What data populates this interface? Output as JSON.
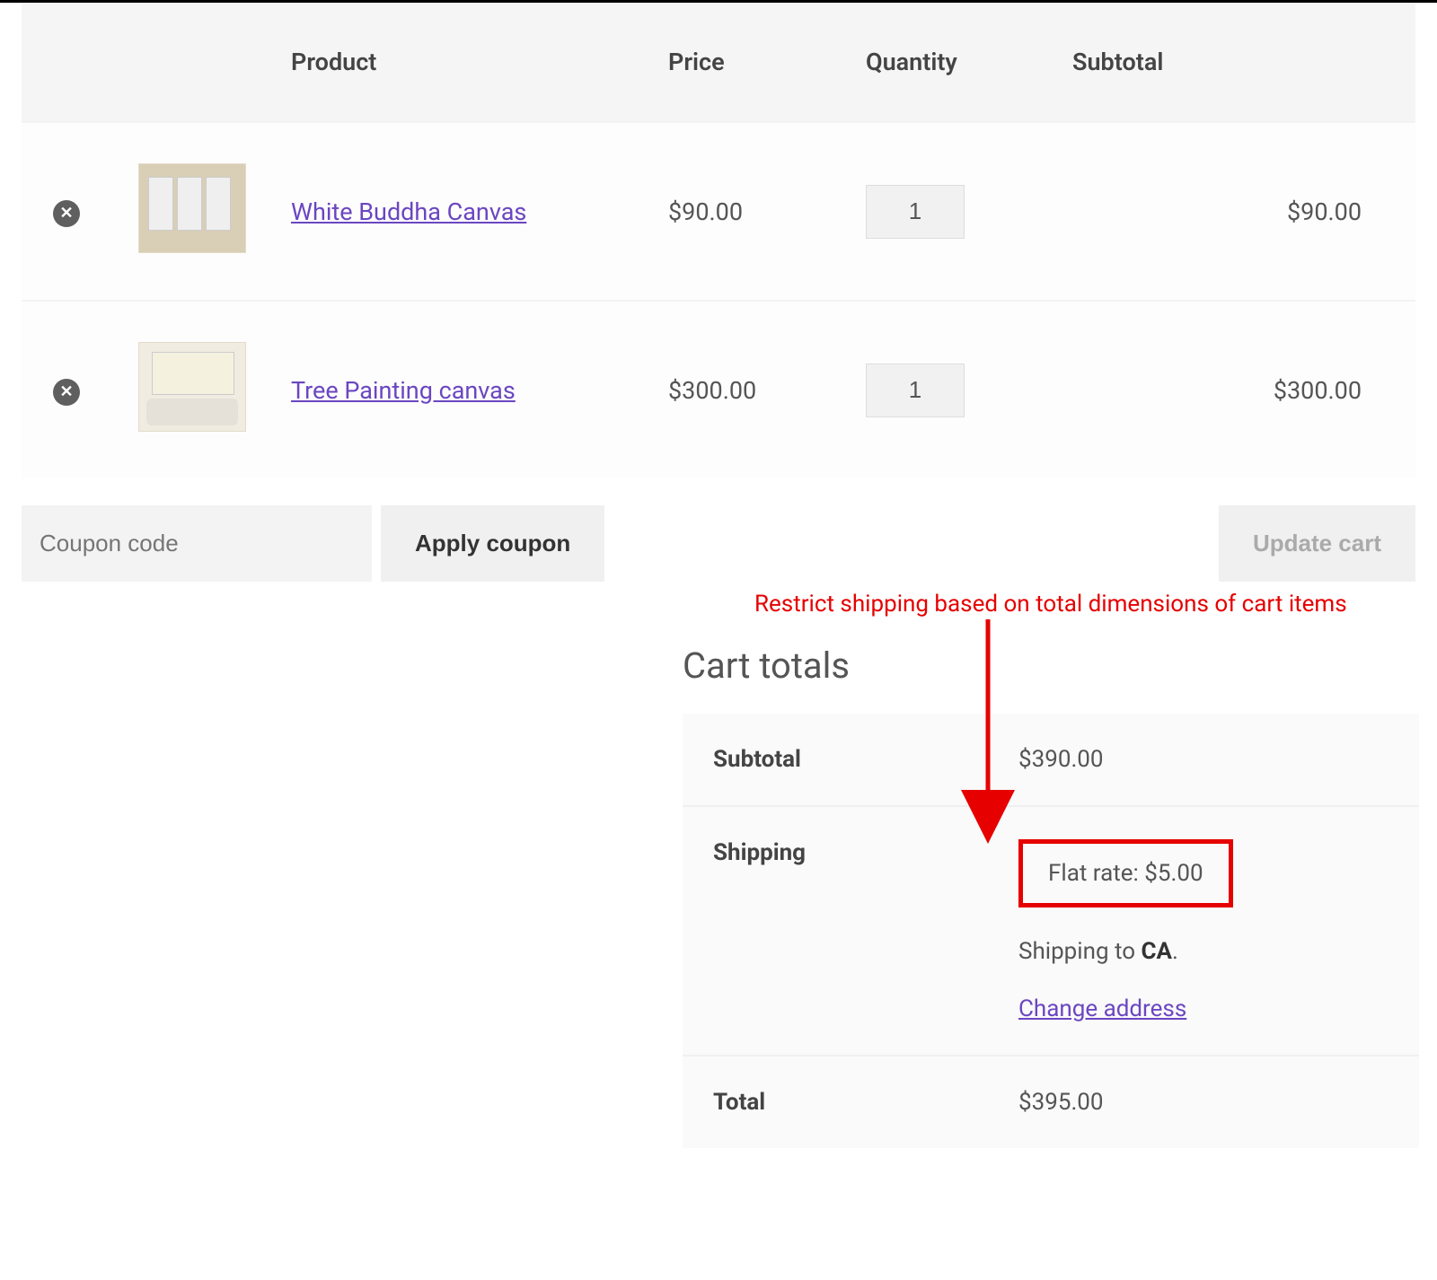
{
  "table": {
    "headers": {
      "product": "Product",
      "price": "Price",
      "quantity": "Quantity",
      "subtotal": "Subtotal"
    },
    "rows": [
      {
        "name": "White Buddha Canvas",
        "price": "$90.00",
        "qty": "1",
        "subtotal": "$90.00"
      },
      {
        "name": "Tree Painting canvas",
        "price": "$300.00",
        "qty": "1",
        "subtotal": "$300.00"
      }
    ]
  },
  "coupon": {
    "placeholder": "Coupon code",
    "apply_label": "Apply coupon"
  },
  "update_label": "Update cart",
  "annotation": "Restrict shipping based on total dimensions of cart items",
  "totals": {
    "title": "Cart totals",
    "subtotal_label": "Subtotal",
    "subtotal_value": "$390.00",
    "shipping_label": "Shipping",
    "flat_rate": "Flat rate: $5.00",
    "shipping_to_prefix": "Shipping to ",
    "shipping_to_region": "CA",
    "shipping_to_suffix": ".",
    "change_address": "Change address",
    "total_label": "Total",
    "total_value": "$395.00"
  }
}
